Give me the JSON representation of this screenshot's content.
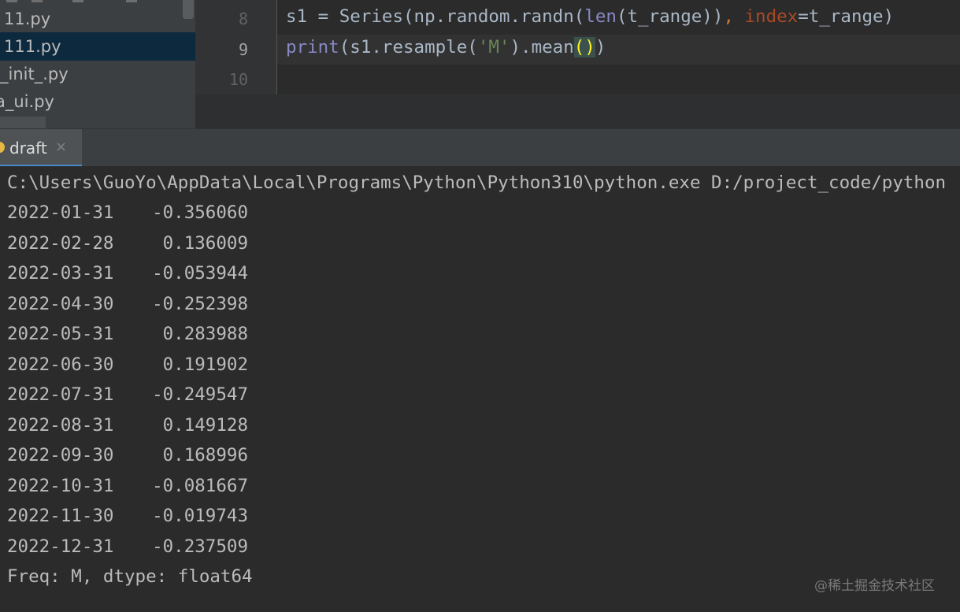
{
  "project_tree": {
    "items": [
      {
        "label": "11.py"
      },
      {
        "label": "111.py",
        "selected": true
      },
      {
        "label": "_init_.py"
      },
      {
        "label": "a_ui.py"
      }
    ]
  },
  "editor": {
    "line_numbers": [
      "8",
      "9",
      "10"
    ],
    "lines": [
      {
        "tokens": [
          {
            "text": "s1 = Series(np.random.randn(",
            "kind": "plain"
          },
          {
            "text": "len",
            "kind": "builtin"
          },
          {
            "text": "(t_range))",
            "kind": "plain"
          },
          {
            "text": ", ",
            "kind": "op"
          },
          {
            "text": "index",
            "kind": "param"
          },
          {
            "text": "=t_range)",
            "kind": "plain"
          }
        ]
      },
      {
        "tokens": [
          {
            "text": "print",
            "kind": "builtin"
          },
          {
            "text": "(s1.resample(",
            "kind": "plain"
          },
          {
            "text": "'M'",
            "kind": "str"
          },
          {
            "text": ").mean",
            "kind": "plain"
          },
          {
            "text": "()",
            "kind": "match"
          },
          {
            "text": ")",
            "kind": "plain"
          }
        ]
      },
      {
        "tokens": []
      }
    ]
  },
  "run": {
    "tab_label": "draft",
    "close_glyph": "×",
    "command": "C:\\Users\\GuoYo\\AppData\\Local\\Programs\\Python\\Python310\\python.exe D:/project_code/python",
    "rows": [
      {
        "date": "2022-01-31",
        "value": "-0.356060"
      },
      {
        "date": "2022-02-28",
        "value": "0.136009"
      },
      {
        "date": "2022-03-31",
        "value": "-0.053944"
      },
      {
        "date": "2022-04-30",
        "value": "-0.252398"
      },
      {
        "date": "2022-05-31",
        "value": "0.283988"
      },
      {
        "date": "2022-06-30",
        "value": "0.191902"
      },
      {
        "date": "2022-07-31",
        "value": "-0.249547"
      },
      {
        "date": "2022-08-31",
        "value": "0.149128"
      },
      {
        "date": "2022-09-30",
        "value": "0.168996"
      },
      {
        "date": "2022-10-31",
        "value": "-0.081667"
      },
      {
        "date": "2022-11-30",
        "value": "-0.019743"
      },
      {
        "date": "2022-12-31",
        "value": "-0.237509"
      }
    ],
    "footer": "Freq: M, dtype: float64"
  },
  "watermark": "@稀土掘金技术社区",
  "colors": {
    "accent": "#4a88c7",
    "selection": "#0d293e",
    "builtin": "#8888c6",
    "param": "#aa4926",
    "string": "#6a8759",
    "operator": "#cc7832",
    "match_bracket": "#ffef28"
  }
}
